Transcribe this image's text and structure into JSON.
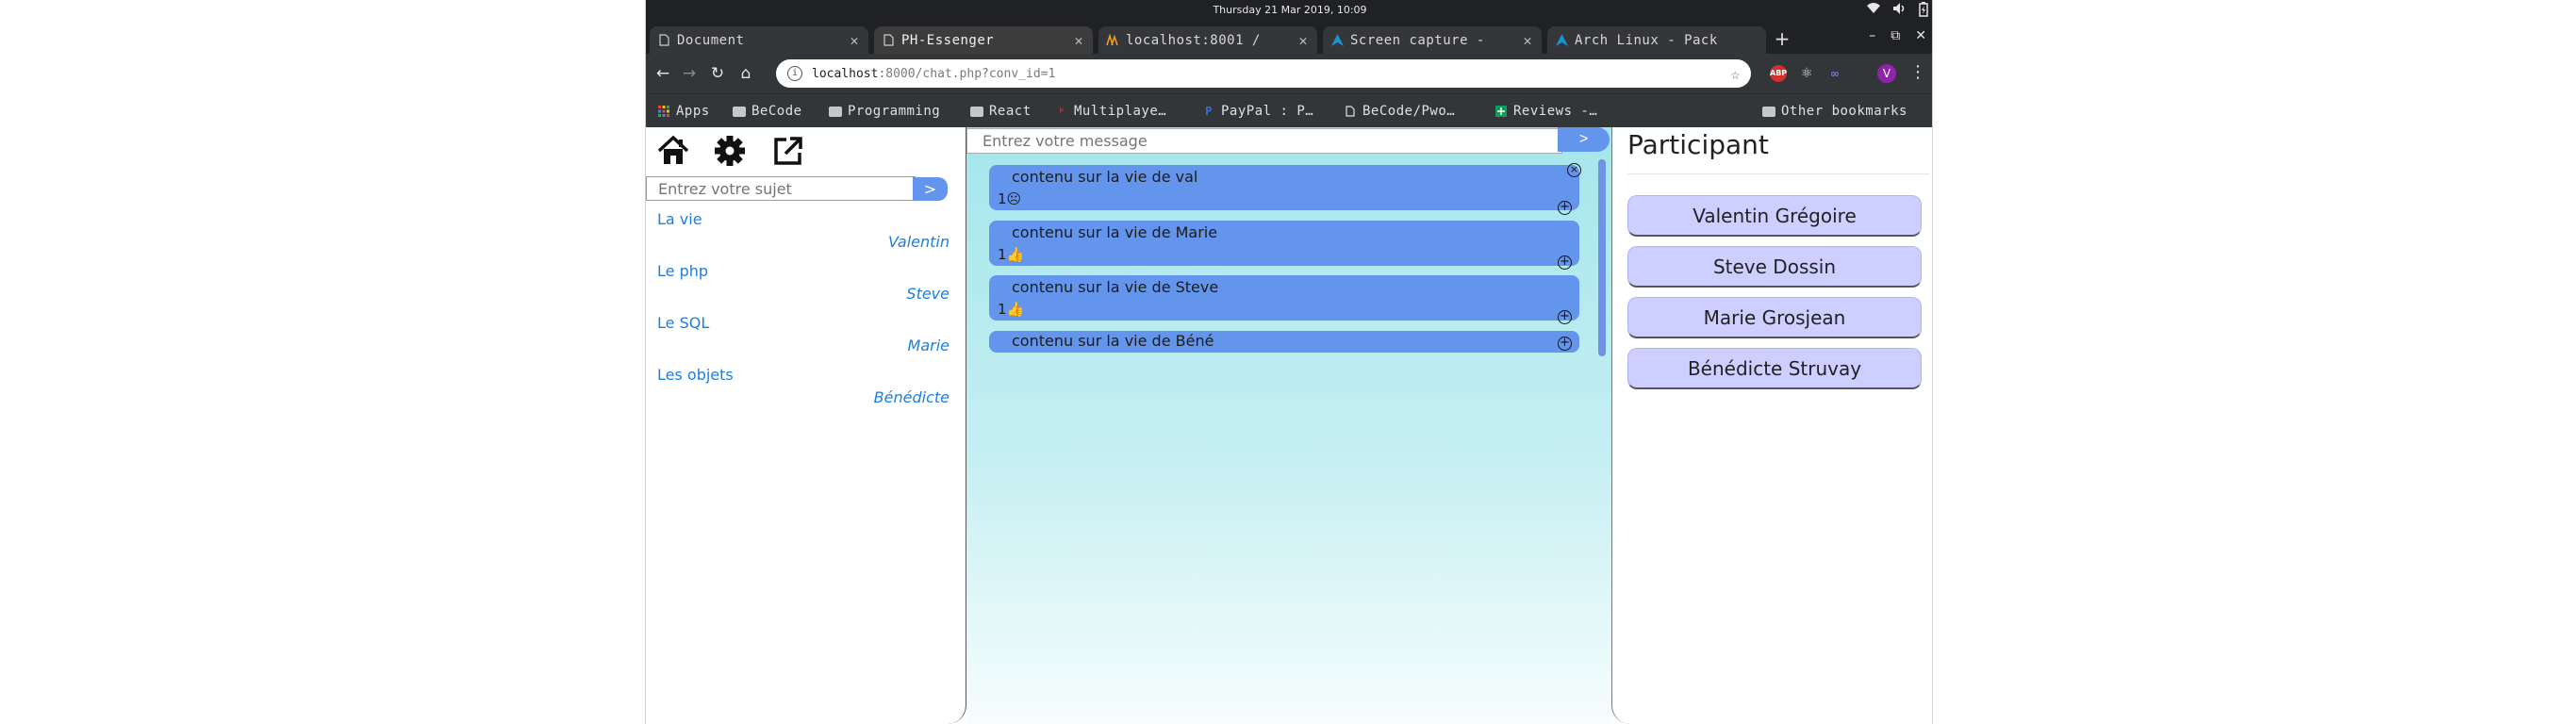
{
  "system": {
    "clock": "Thursday 21 Mar 2019, 10:09"
  },
  "tabs": [
    {
      "title": "Document",
      "icon": "document-icon",
      "close": "✕"
    },
    {
      "title": "PH-Essenger",
      "icon": "document-icon",
      "close": "✕"
    },
    {
      "title": "localhost:8001 / ",
      "icon": "phpmyadmin-icon",
      "close": "✕"
    },
    {
      "title": "Screen capture - ",
      "icon": "arch-icon",
      "close": "✕"
    },
    {
      "title": "Arch Linux - Pack",
      "icon": "arch-icon",
      "close": ""
    }
  ],
  "omnibox": {
    "host": "localhost",
    "path": ":8000/chat.php?conv_id=1"
  },
  "bookmarks": [
    {
      "label": "Apps",
      "icon": "apps-icon"
    },
    {
      "label": "BeCode",
      "icon": "folder-icon"
    },
    {
      "label": "Programming",
      "icon": "folder-icon"
    },
    {
      "label": "React",
      "icon": "folder-icon"
    },
    {
      "label": "Multiplaye…",
      "icon": "pin-icon"
    },
    {
      "label": "PayPal : P…",
      "icon": "paypal-icon"
    },
    {
      "label": "BeCode/Pwo…",
      "icon": "document-icon"
    },
    {
      "label": "Reviews -…",
      "icon": "reviews-icon"
    },
    {
      "label": "Other bookmarks",
      "icon": "folder-icon"
    }
  ],
  "sidebar": {
    "subject_placeholder": "Entrez votre sujet",
    "subject_submit": ">",
    "subjects": [
      {
        "title": "La vie",
        "author": "Valentin"
      },
      {
        "title": "Le php",
        "author": "Steve"
      },
      {
        "title": "Le SQL",
        "author": "Marie"
      },
      {
        "title": "Les objets",
        "author": "Bénédicte"
      }
    ]
  },
  "chat": {
    "message_placeholder": "Entrez votre message",
    "message_submit": ">",
    "messages": [
      {
        "text": "contenu sur la vie de val",
        "likes": "1☹"
      },
      {
        "text": "contenu sur la vie de Marie",
        "likes": "1👍"
      },
      {
        "text": "contenu sur la vie de Steve",
        "likes": "1👍"
      },
      {
        "text": "contenu sur la vie de Béné",
        "likes": ""
      }
    ]
  },
  "participants": {
    "title": "Participant",
    "names": [
      "Valentin Grégoire",
      "Steve Dossin",
      "Marie Grosjean",
      "Bénédicte Struvay"
    ]
  },
  "colors": {
    "accent": "#6495ed",
    "link": "#1e7ee0",
    "participant_bg": "#cccfff",
    "chat_bg_top": "#a4e6ec"
  }
}
